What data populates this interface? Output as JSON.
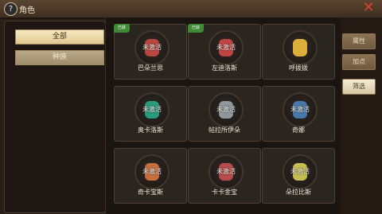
{
  "header": {
    "title": "角色",
    "icon": "question-icon",
    "close_icon": "close-icon"
  },
  "sidebar": {
    "tabs": [
      {
        "label": "全部"
      },
      {
        "label": "种族"
      }
    ]
  },
  "right_tabs": [
    {
      "label": "属性"
    },
    {
      "label": "加点"
    },
    {
      "label": "筛选"
    }
  ],
  "cards": [
    {
      "name": "巴朵兰思",
      "status": "未激活",
      "badge": "已获",
      "silhouette_color": "#c84b43"
    },
    {
      "name": "左迪洛斯",
      "status": "未激活",
      "badge": "已获",
      "silhouette_color": "#d14747"
    },
    {
      "name": "呼拨拨",
      "status": "",
      "badge": "",
      "silhouette_color": "#f0bf3e"
    },
    {
      "name": "奥卡洛斯",
      "status": "未激活",
      "badge": "",
      "silhouette_color": "#29a88a"
    },
    {
      "name": "帖拉所伊朵",
      "status": "未激活",
      "badge": "",
      "silhouette_color": "#9aa4ad"
    },
    {
      "name": "奇娜",
      "status": "未激活",
      "badge": "",
      "silhouette_color": "#4a82b8"
    },
    {
      "name": "奇卡宝斯",
      "status": "未激活",
      "badge": "",
      "silhouette_color": "#d77841"
    },
    {
      "name": "卡卡金宝",
      "status": "未激活",
      "badge": "",
      "silhouette_color": "#c84f4f"
    },
    {
      "name": "朵拉比斯",
      "status": "未激活",
      "badge": "",
      "silhouette_color": "#d8cf57"
    }
  ]
}
